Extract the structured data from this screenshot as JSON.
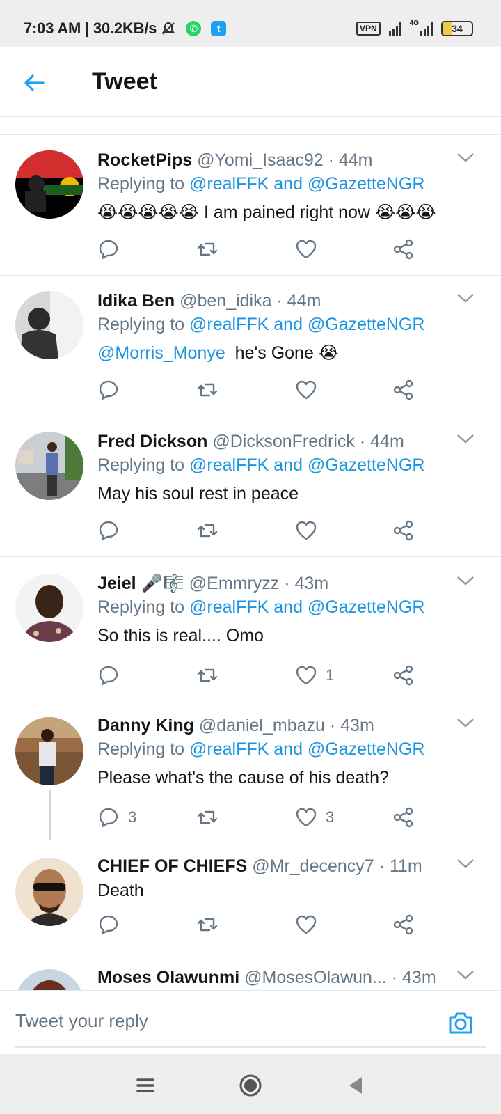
{
  "status_bar": {
    "time_speed": "7:03 AM | 30.2KB/s",
    "vpn": "VPN",
    "network": "4G",
    "battery": "34"
  },
  "header": {
    "title": "Tweet"
  },
  "tweets": [
    {
      "name": "RocketPips",
      "handle": "@Yomi_Isaac92",
      "dot": "·",
      "time": "44m",
      "replying_prefix": "Replying to",
      "replying_targets": "@realFFK and @GazetteNGR",
      "text": "😭😭😭😭😭 I am pained right now 😭😭😭",
      "replies": "",
      "likes": ""
    },
    {
      "name": "Idika Ben",
      "handle": "@ben_idika",
      "dot": "·",
      "time": "44m",
      "replying_prefix": "Replying to",
      "replying_targets": "@realFFK and @GazetteNGR",
      "text_mention": "@Morris_Monye",
      "text": "he's Gone 😭",
      "replies": "",
      "likes": ""
    },
    {
      "name": "Fred Dickson",
      "handle": "@DicksonFredrick",
      "dot": "·",
      "time": "44m",
      "replying_prefix": "Replying to",
      "replying_targets": "@realFFK and @GazetteNGR",
      "text": "May his soul rest in peace",
      "replies": "",
      "likes": ""
    },
    {
      "name": "Jeiel 🎤🎼",
      "handle": "@Emmryzz",
      "dot": "·",
      "time": "43m",
      "replying_prefix": "Replying to",
      "replying_targets": "@realFFK and @GazetteNGR",
      "text": "So this is real.... Omo",
      "replies": "",
      "likes": "1"
    },
    {
      "name": "Danny King",
      "handle": "@daniel_mbazu",
      "dot": "·",
      "time": "43m",
      "replying_prefix": "Replying to",
      "replying_targets": "@realFFK and @GazetteNGR",
      "text": "Please what's the cause of his death?",
      "replies": "3",
      "likes": "3"
    },
    {
      "name": "CHIEF OF CHIEFS",
      "handle": "@Mr_decency7",
      "dot": "·",
      "time": "11m",
      "text": "Death",
      "replies": "",
      "likes": ""
    },
    {
      "name": "Moses Olawunmi",
      "handle": "@MosesOlawun...",
      "dot": "·",
      "time": "43m"
    }
  ],
  "reply_bar": {
    "placeholder": "Tweet your reply"
  },
  "colors": {
    "accent": "#1b95e0",
    "text": "#14171a",
    "muted": "#657786",
    "divider": "#e1e8ed"
  }
}
